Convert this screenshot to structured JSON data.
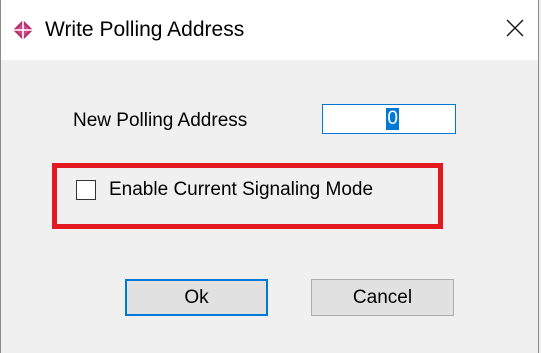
{
  "window": {
    "title": "Write Polling Address",
    "icon": "diamond-app-icon",
    "close_icon": "close-icon"
  },
  "form": {
    "polling_address_label": "New Polling Address",
    "polling_address_value": "0",
    "current_signaling_label": "Enable Current Signaling Mode",
    "current_signaling_checked": false
  },
  "buttons": {
    "ok_label": "Ok",
    "cancel_label": "Cancel"
  },
  "colors": {
    "highlight": "#e2191f",
    "accent": "#0078d7",
    "icon": "#b0306a"
  }
}
